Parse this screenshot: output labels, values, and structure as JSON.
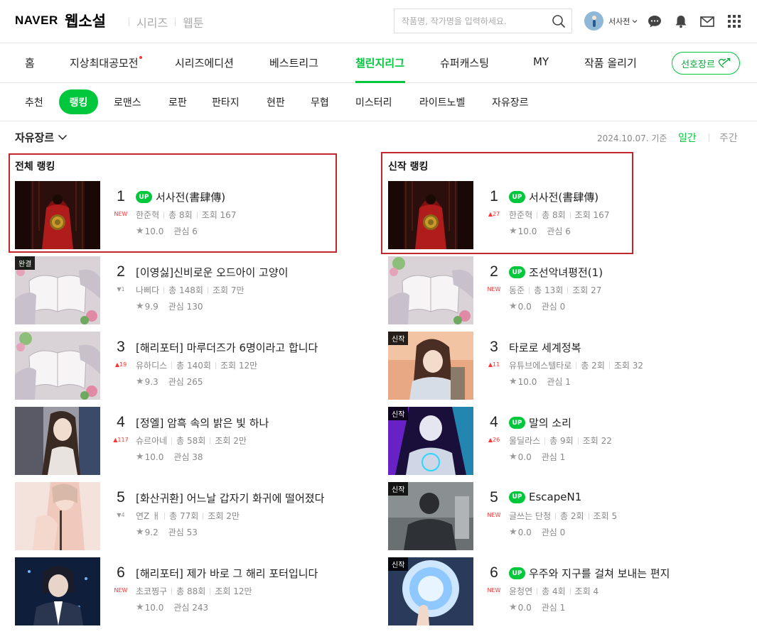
{
  "header": {
    "logo": "NAVER",
    "service": "웹소설",
    "links": [
      "시리즈",
      "웹툰"
    ],
    "search_placeholder": "작품명, 작가명을 입력하세요.",
    "user_name": "서사전"
  },
  "main_nav": {
    "items": [
      "홈",
      "지상최대공모전",
      "시리즈에디션",
      "베스트리그",
      "챌린지리그",
      "슈퍼캐스팅",
      "MY",
      "작품 올리기"
    ],
    "active": "챌린지리그",
    "genre_pref": "선호장르"
  },
  "sub_nav": {
    "items": [
      "추천",
      "랭킹",
      "로맨스",
      "로판",
      "판타지",
      "현판",
      "무협",
      "미스터리",
      "라이트노벨",
      "자유장르"
    ],
    "active": "랭킹"
  },
  "filter": {
    "genre": "자유장르",
    "date_ref": "2024.10.07. 기준",
    "daily": "일간",
    "weekly": "주간"
  },
  "overall": {
    "title": "전체 랭킹",
    "items": [
      {
        "rank": "1",
        "change": "NEW",
        "up": true,
        "title": "서사전(書肆傳)",
        "author": "한준혁",
        "episodes": "총 8회",
        "views": "조회 167",
        "rating": "10.0",
        "interest": "관심 6",
        "tag": ""
      },
      {
        "rank": "2",
        "change": "▼1",
        "up": false,
        "title": "[이영싫]신비로운 오드아이 고양이",
        "author": "나삐다",
        "episodes": "총 148회",
        "views": "조회 7만",
        "rating": "9.9",
        "interest": "관심 130",
        "tag": "완결"
      },
      {
        "rank": "3",
        "change": "▲19",
        "up": false,
        "title": "[해리포터] 마루더즈가 6명이라고 합니다",
        "author": "유하디스",
        "episodes": "총 140회",
        "views": "조회 12만",
        "rating": "9.3",
        "interest": "관심 265",
        "tag": ""
      },
      {
        "rank": "4",
        "change": "▲117",
        "up": false,
        "title": "[정엘] 암흑 속의 밝은 빛 하나",
        "author": "슈르아네",
        "episodes": "총 58회",
        "views": "조회 2만",
        "rating": "10.0",
        "interest": "관심 38",
        "tag": ""
      },
      {
        "rank": "5",
        "change": "▼4",
        "up": false,
        "title": "[화산귀환] 어느날 갑자기 화귀에 떨어졌다",
        "author": "연Z ㅐ",
        "episodes": "총 77회",
        "views": "조회 2만",
        "rating": "9.2",
        "interest": "관심 53",
        "tag": ""
      },
      {
        "rank": "6",
        "change": "NEW",
        "up": false,
        "title": "[해리포터] 제가 바로 그 해리 포터입니다",
        "author": "초코찡구",
        "episodes": "총 88회",
        "views": "조회 12만",
        "rating": "10.0",
        "interest": "관심 243",
        "tag": ""
      }
    ]
  },
  "new": {
    "title": "신작 랭킹",
    "items": [
      {
        "rank": "1",
        "change": "▲27",
        "up": true,
        "title": "서사전(書肆傳)",
        "author": "한준혁",
        "episodes": "총 8회",
        "views": "조회 167",
        "rating": "10.0",
        "interest": "관심 6",
        "tag": ""
      },
      {
        "rank": "2",
        "change": "NEW",
        "up": true,
        "title": "조선악녀평전(1)",
        "author": "동준",
        "episodes": "총 13회",
        "views": "조회 27",
        "rating": "0.0",
        "interest": "관심 0",
        "tag": ""
      },
      {
        "rank": "3",
        "change": "▲11",
        "up": false,
        "title": "타로로 세계정복",
        "author": "유튜브에스텔타로",
        "episodes": "총 2회",
        "views": "조회 32",
        "rating": "10.0",
        "interest": "관심 1",
        "tag": "신작"
      },
      {
        "rank": "4",
        "change": "▲26",
        "up": true,
        "title": "말의 소리",
        "author": "울딜라스",
        "episodes": "총 9회",
        "views": "조회 22",
        "rating": "0.0",
        "interest": "관심 1",
        "tag": "신작"
      },
      {
        "rank": "5",
        "change": "NEW",
        "up": true,
        "title": "EscapeN1",
        "author": "글쓰는 단청",
        "episodes": "총 2회",
        "views": "조회 5",
        "rating": "0.0",
        "interest": "관심 0",
        "tag": "신작"
      },
      {
        "rank": "6",
        "change": "NEW",
        "up": true,
        "title": "우주와 지구를 걸쳐 보내는 편지",
        "author": "윤청연",
        "episodes": "총 4회",
        "views": "조회 4",
        "rating": "0.0",
        "interest": "관심 1",
        "tag": "신작"
      }
    ]
  },
  "badge_up": "UP",
  "colors": {
    "brand": "#00c73c",
    "highlight": "#c0282d",
    "rank_up": "#ff3333"
  }
}
